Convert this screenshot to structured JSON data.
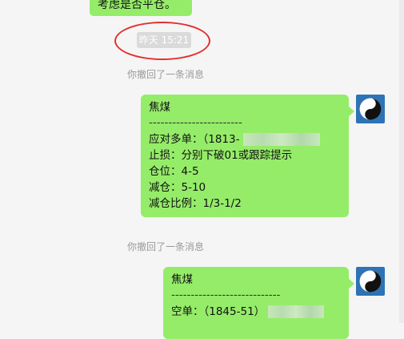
{
  "previous_message": {
    "visible_text": "考虑是否平仓。"
  },
  "timestamp": "昨天 15:21",
  "system_notices": [
    "你撤回了一条消息",
    "你撤回了一条消息"
  ],
  "messages": [
    {
      "lines": [
        "焦煤",
        "------------------------",
        "应对多单：（1813-",
        "止损：分别下破01或跟踪提示",
        "仓位：4-5",
        "减仓：5-10",
        "减仓比例：1/3-1/2"
      ]
    },
    {
      "lines": [
        "焦煤",
        "----------------------------",
        "空单：（1845-51）"
      ]
    }
  ],
  "avatar_icon": "yin-yang-icon",
  "colors": {
    "bubble": "#95ec69",
    "annotation": "#e2302e",
    "avatar_bg": "#2d73b5"
  }
}
